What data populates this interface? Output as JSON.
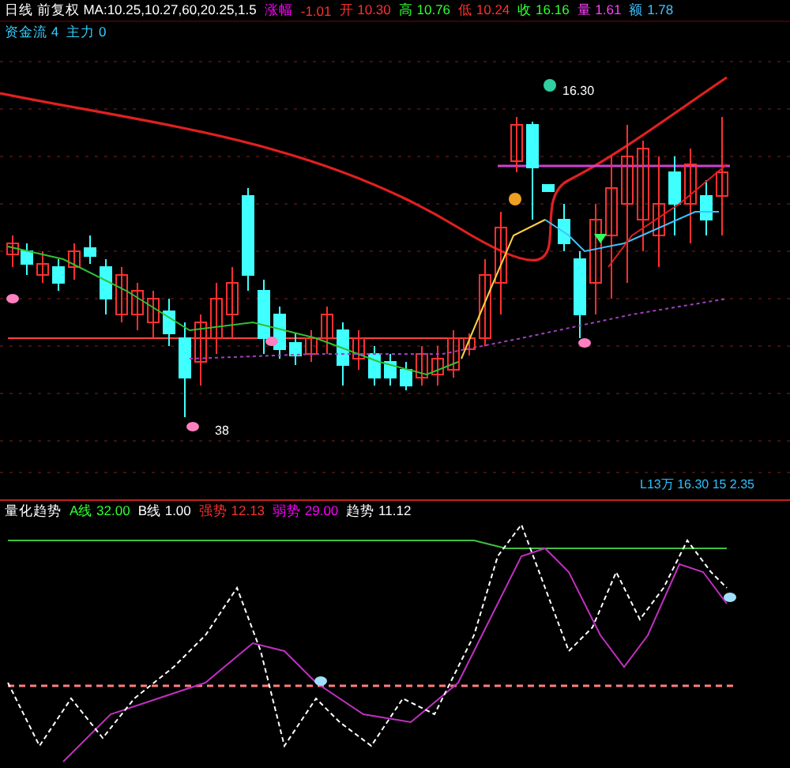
{
  "price_header": [
    {
      "text": "日线 前复权 MA:10.25,10.27,60,20.25,1.5",
      "color": "#ffffff"
    },
    {
      "text": "涨幅",
      "color": "#ff00ff"
    },
    {
      "text": "-1.01",
      "color": "#ff3030"
    },
    {
      "text": "开 10.30",
      "color": "#ff3030"
    },
    {
      "text": "高 10.76",
      "color": "#30ff30"
    },
    {
      "text": "低 10.24",
      "color": "#ff3030"
    },
    {
      "text": "收 16.16",
      "color": "#30ff30"
    },
    {
      "text": "量 1.61",
      "color": "#ff40ff"
    },
    {
      "text": "额 1.78",
      "color": "#40c0ff"
    }
  ],
  "fund_header": [
    {
      "text": "资金流 4",
      "color": "#30d0ff"
    },
    {
      "text": "主力 0",
      "color": "#30d0ff"
    }
  ],
  "chart_labels": {
    "high_mark": "16.30",
    "low_mark": "38",
    "summary": "L13万 16.30 15 2.35"
  },
  "indicator_header": [
    {
      "text": "量化趋势",
      "color": "#ffffff"
    },
    {
      "text": "A线 32.00",
      "color": "#30ff30"
    },
    {
      "text": "B线 1.00",
      "color": "#ffffff"
    },
    {
      "text": "强势 12.13",
      "color": "#ff3030"
    },
    {
      "text": "弱势 29.00",
      "color": "#ff00ff"
    },
    {
      "text": "趋势 11.12",
      "color": "#ffffff"
    }
  ]
}
